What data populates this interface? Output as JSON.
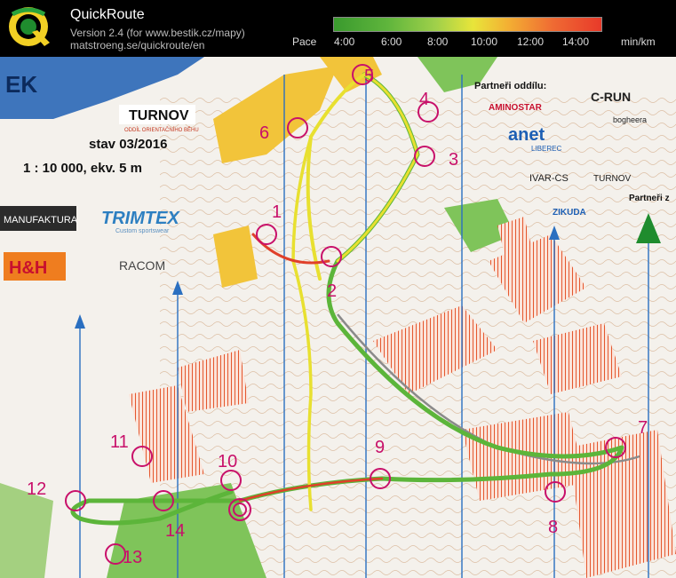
{
  "app": {
    "title": "QuickRoute",
    "version": "Version 2.4  (for www.bestik.cz/mapy)",
    "url": "matstroeng.se/quickroute/en"
  },
  "pace": {
    "label": "Pace",
    "ticks": [
      "4:00",
      "6:00",
      "8:00",
      "10:00",
      "12:00",
      "14:00"
    ],
    "unit": "min/km",
    "gradient_colors": [
      "#3a9a2e",
      "#9fd04a",
      "#e8e53a",
      "#f3b033",
      "#e83a2a"
    ]
  },
  "map": {
    "header_fragment": "EK",
    "club_logo": "TURNOV",
    "club_subtitle": "ODDÍL ORIENTAČNÍHO BĚHU",
    "state": "stav 03/2016",
    "scale": "1 : 10 000, ekv. 5 m",
    "sponsors_left": [
      "MANUFAKTURA",
      "TRIMTEX",
      "Custom sportswear",
      "H&H",
      "RACOM"
    ],
    "partners_title": "Partneři oddílu:",
    "partners": [
      "AMINOSTAR",
      "C-RUN",
      "bogheera",
      "anet",
      "LIBEREC",
      "IVAR-CS",
      "TURNOV",
      "ZIKUDA"
    ],
    "partners_title2": "Partneři z",
    "controls": [
      "1",
      "2",
      "3",
      "4",
      "5",
      "6",
      "7",
      "8",
      "9",
      "10",
      "11",
      "12",
      "13",
      "14"
    ],
    "colors": {
      "route_green": "#5cb53a",
      "route_yellow": "#e8e030",
      "route_red": "#e0402a",
      "controls": "#c8106a"
    }
  }
}
